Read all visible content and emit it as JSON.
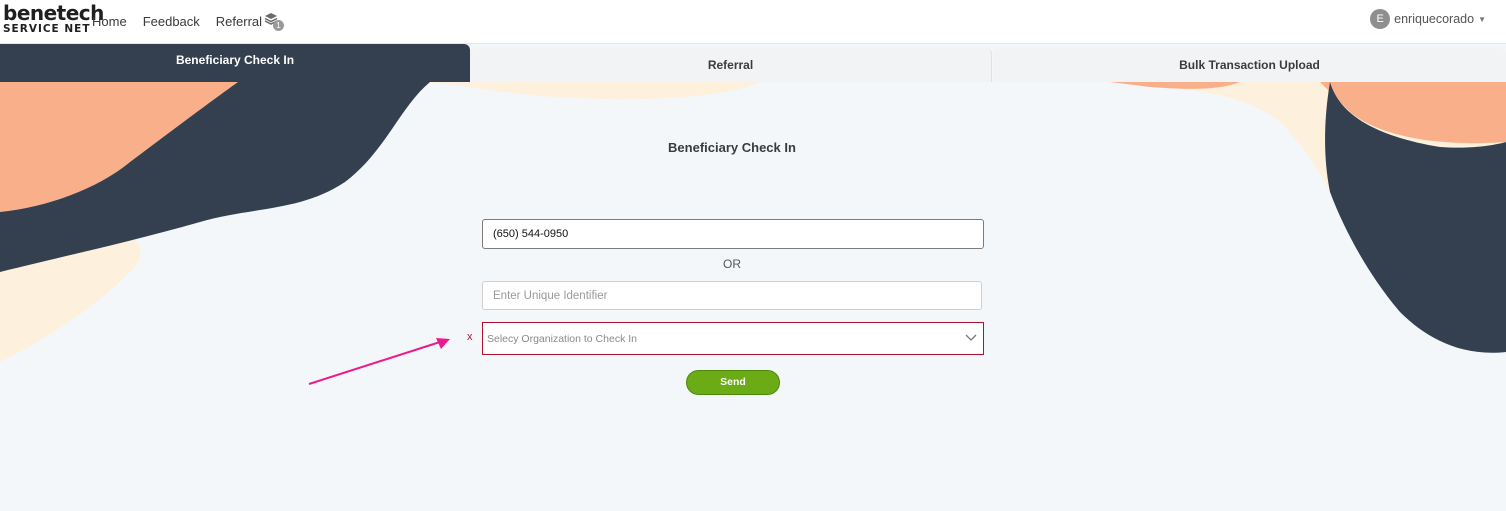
{
  "header": {
    "logo_main": "benetech",
    "logo_sub": "SERVICE NET",
    "nav": [
      {
        "label": "Home"
      },
      {
        "label": "Feedback"
      },
      {
        "label": "Referral",
        "badge": "1"
      }
    ],
    "user": {
      "initial": "E",
      "name": "enriquecorado"
    }
  },
  "tabs": [
    {
      "label": "Beneficiary Check In",
      "active": true
    },
    {
      "label": "Referral",
      "active": false
    },
    {
      "label": "Bulk Transaction Upload",
      "active": false
    }
  ],
  "form": {
    "title": "Beneficiary Check In",
    "phone_value": "(650) 544-0950",
    "or_text": "OR",
    "uid_placeholder": "Enter Unique Identifier",
    "error_marker": "x",
    "org_placeholder": "Selecy Organization to Check In",
    "send_label": "Send"
  },
  "colors": {
    "navy": "#34404f",
    "peach": "#f9b08a",
    "cream": "#fdf0dc",
    "error": "#b0102a",
    "send": "#6aab16",
    "annotation_arrow": "#ee1a8c"
  }
}
